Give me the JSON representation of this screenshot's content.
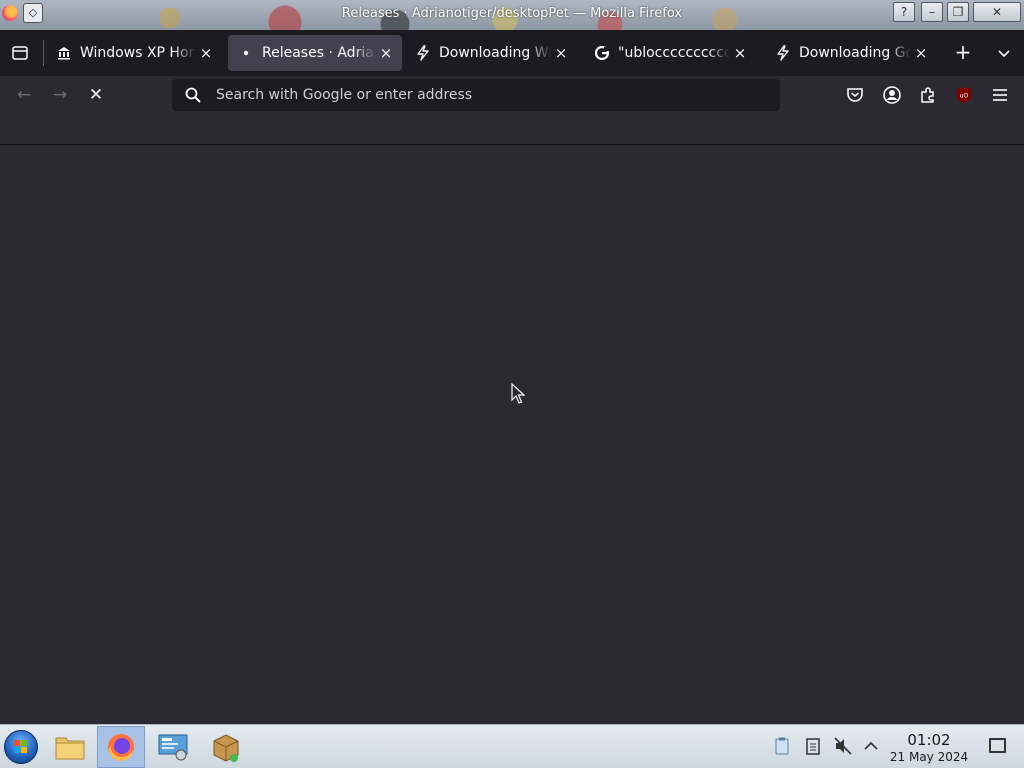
{
  "window": {
    "title": "Releases · Adrianotiger/desktopPet — Mozilla Firefox",
    "buttons": {
      "help": "?",
      "minimize": "–",
      "maximize": "❐",
      "close": "✕"
    }
  },
  "tabs": [
    {
      "label": "Windows XP Horror",
      "icon": "museum-icon",
      "active": false
    },
    {
      "label": "Releases · Adrianotiger/desktopPet",
      "icon": "loading-dot-icon",
      "active": true
    },
    {
      "label": "Downloading Windows",
      "icon": "lightning-icon",
      "active": false
    },
    {
      "label": "\"ublocccccccccccccc",
      "icon": "google-icon",
      "active": false
    },
    {
      "label": "Downloading Google",
      "icon": "lightning-icon",
      "active": false
    }
  ],
  "tabstrip": {
    "new_tab": "+",
    "list_all": "⌄"
  },
  "navbar": {
    "back": "←",
    "forward": "→",
    "stop": "✕",
    "url_placeholder": "Search with Google or enter address",
    "url_value": ""
  },
  "taskbar": {
    "apps": [
      "file-manager-icon",
      "firefox-icon",
      "system-settings-icon",
      "package-installer-icon"
    ],
    "time": "01:02",
    "date": "21 May 2024"
  },
  "colors": {
    "accent": "#42414d",
    "background": "#2b2a33",
    "tab_strip": "#1c1b22",
    "taskbar": "#d7dee6"
  }
}
